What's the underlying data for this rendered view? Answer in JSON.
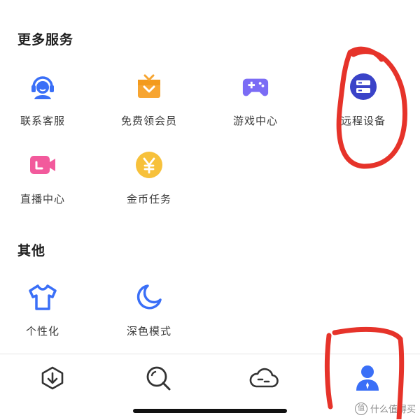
{
  "sections": {
    "more_services": {
      "title": "更多服务",
      "items": [
        {
          "label": "联系客服",
          "icon": "headset-icon"
        },
        {
          "label": "免费领会员",
          "icon": "gift-icon"
        },
        {
          "label": "游戏中心",
          "icon": "gamepad-icon"
        },
        {
          "label": "远程设备",
          "icon": "server-icon"
        },
        {
          "label": "直播中心",
          "icon": "video-icon"
        },
        {
          "label": "金币任务",
          "icon": "yen-coin-icon"
        }
      ]
    },
    "other": {
      "title": "其他",
      "items": [
        {
          "label": "个性化",
          "icon": "tshirt-icon"
        },
        {
          "label": "深色模式",
          "icon": "moon-icon"
        }
      ]
    }
  },
  "bottom_nav": {
    "tabs": [
      {
        "icon": "download-icon"
      },
      {
        "icon": "search-icon"
      },
      {
        "icon": "cloud-icon"
      },
      {
        "icon": "profile-icon",
        "active": true
      }
    ]
  },
  "watermark": {
    "text": "什么值得买",
    "logo": "值"
  },
  "colors": {
    "accent_blue": "#3a6ff7",
    "orange": "#f7a531",
    "purple": "#7b6cf5",
    "navy": "#3a43c8",
    "pink": "#f25a9c",
    "yellow": "#f7c13b",
    "annotation_red": "#e6332a"
  }
}
